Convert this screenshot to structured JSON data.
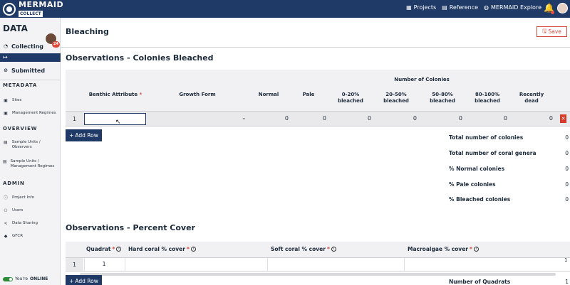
{
  "topbar": {
    "logo_main": "MERMAID",
    "logo_sub": "COLLECT",
    "nav": [
      {
        "label": "Projects",
        "icon": "projects-icon"
      },
      {
        "label": "Reference",
        "icon": "reference-icon"
      },
      {
        "label": "MERMAID Explore",
        "icon": "globe-icon"
      }
    ]
  },
  "sidebar": {
    "title": "DATA",
    "badge": "24",
    "collecting": "Collecting",
    "submitted": "Submitted",
    "sections": {
      "metadata": "METADATA",
      "overview": "OVERVIEW",
      "admin": "ADMIN"
    },
    "metadata_items": [
      "Sites",
      "Management Regimes"
    ],
    "overview_items": [
      "Sample Units / Observers",
      "Sample Units / Management Regimes"
    ],
    "admin_items": [
      "Project Info",
      "Users",
      "Data Sharing",
      "GFCR"
    ],
    "online_prefix": "You're",
    "online_status": "ONLINE"
  },
  "page": {
    "title": "Bleaching",
    "save_label": "Save"
  },
  "colonies": {
    "title": "Observations - Colonies Bleached",
    "group_header": "Number of Colonies",
    "columns": {
      "benthic": "Benthic Attribute",
      "growth": "Growth Form",
      "normal": "Normal",
      "pale": "Pale",
      "b0_20": "0-20% bleached",
      "b20_50": "20-50% bleached",
      "b50_80": "50-80% bleached",
      "b80_100": "80-100% bleached",
      "recent": "Recently dead"
    },
    "rows": [
      {
        "num": "1",
        "values": [
          "0",
          "0",
          "0",
          "0",
          "0",
          "0",
          "0"
        ]
      }
    ],
    "add_row": "Add Row",
    "summary": [
      {
        "label": "Total number of colonies",
        "value": "0"
      },
      {
        "label": "Total number of coral genera",
        "value": "0"
      },
      {
        "label": "% Normal colonies",
        "value": "0"
      },
      {
        "label": "% Pale colonies",
        "value": "0"
      },
      {
        "label": "% Bleached colonies",
        "value": "0"
      }
    ]
  },
  "percent_cover": {
    "title": "Observations - Percent Cover",
    "columns": {
      "quadrat": "Quadrat",
      "hard": "Hard coral % cover",
      "soft": "Soft coral % cover",
      "macro": "Macroalgae % cover"
    },
    "rows": [
      {
        "num": "1",
        "quadrat": "1",
        "extra": "1"
      }
    ],
    "add_row": "Add Row",
    "summary_label": "Number of Quadrats",
    "summary_value": "1"
  }
}
